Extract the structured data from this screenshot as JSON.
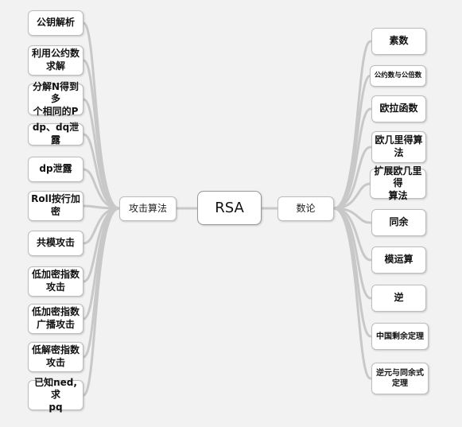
{
  "root": {
    "label": "RSA"
  },
  "left_branch": {
    "label": "攻击算法",
    "items": [
      {
        "label": "公钥解析"
      },
      {
        "label": "利用公约数\n求解"
      },
      {
        "label": "分解N得到多\n个相同的P"
      },
      {
        "label": "dp、dq泄露"
      },
      {
        "label": "dp泄露"
      },
      {
        "label": "Roll按行加\n密"
      },
      {
        "label": "共模攻击"
      },
      {
        "label": "低加密指数\n攻击"
      },
      {
        "label": "低加密指数\n广播攻击"
      },
      {
        "label": "低解密指数\n攻击"
      },
      {
        "label": "已知ned,求\npq"
      }
    ]
  },
  "right_branch": {
    "label": "数论",
    "items": [
      {
        "label": "素数"
      },
      {
        "label": "公约数与公倍数"
      },
      {
        "label": "欧拉函数"
      },
      {
        "label": "欧几里得算\n法"
      },
      {
        "label": "扩展欧几里得\n算法"
      },
      {
        "label": "同余"
      },
      {
        "label": "模运算"
      },
      {
        "label": "逆"
      },
      {
        "label": "中国剩余定理"
      },
      {
        "label": "逆元与同余式\n定理"
      }
    ]
  }
}
